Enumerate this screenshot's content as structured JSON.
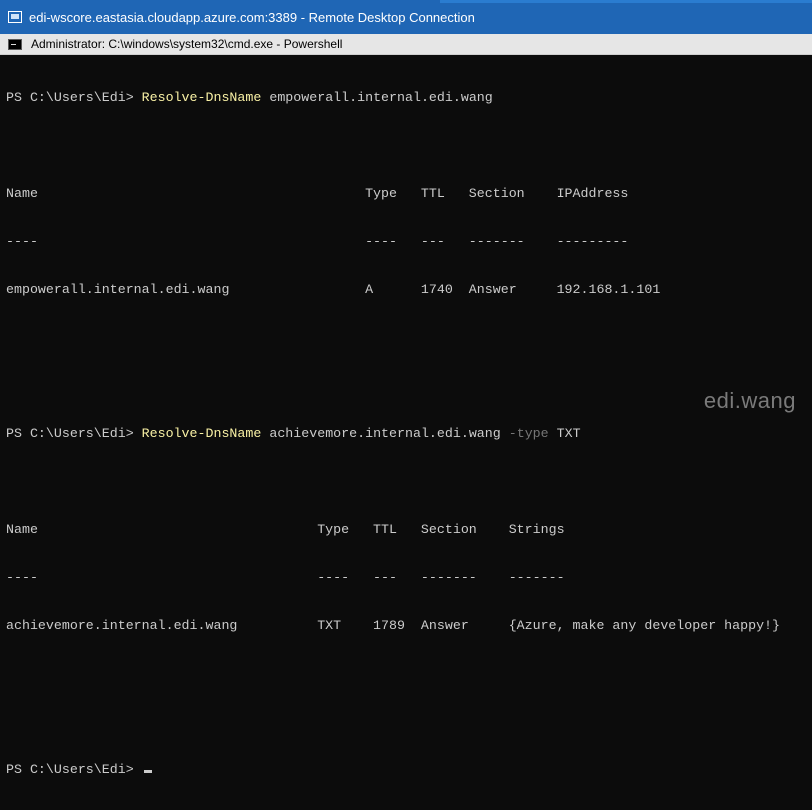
{
  "rdp": {
    "title": "edi-wscore.eastasia.cloudapp.azure.com:3389 - Remote Desktop Connection"
  },
  "cmd": {
    "title": "Administrator: C:\\windows\\system32\\cmd.exe - Powershell"
  },
  "console": {
    "prompt1": "PS C:\\Users\\Edi> ",
    "cmd1_name": "Resolve-DnsName",
    "cmd1_args": " empowerall.internal.edi.wang",
    "table1": {
      "header": "Name                                         Type   TTL   Section    IPAddress",
      "sep": "----                                         ----   ---   -------    ---------",
      "row": "empowerall.internal.edi.wang                 A      1740  Answer     192.168.1.101"
    },
    "prompt2": "PS C:\\Users\\Edi> ",
    "cmd2_name": "Resolve-DnsName",
    "cmd2_args": " achievemore.internal.edi.wang ",
    "cmd2_param": "-type",
    "cmd2_value": " TXT",
    "table2": {
      "header": "Name                                   Type   TTL   Section    Strings",
      "sep": "----                                   ----   ---   -------    -------",
      "row": "achievemore.internal.edi.wang          TXT    1789  Answer     {Azure, make any developer happy!}"
    },
    "prompt3": "PS C:\\Users\\Edi> "
  },
  "watermark": "edi.wang"
}
